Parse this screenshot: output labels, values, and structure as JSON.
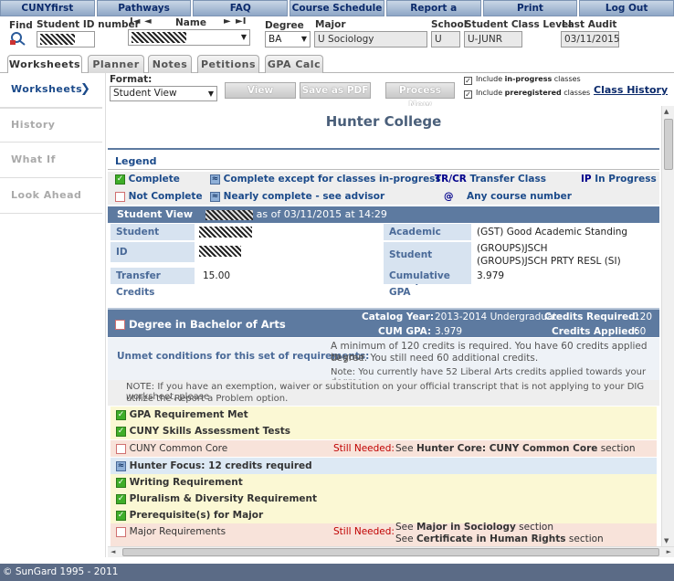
{
  "topnav": [
    "CUNYfirst",
    "Pathways",
    "FAQ",
    "Course Schedule",
    "Report a Problem",
    "Print",
    "Log Out"
  ],
  "header": {
    "find_label": "Find",
    "student_id_label": "Student ID number",
    "nav_first": "I◄",
    "nav_prev": "◄",
    "name_label": "Name",
    "nav_next": "►",
    "nav_last": "►I",
    "degree_label": "Degree",
    "degree_value": "BA",
    "major_label": "Major",
    "major_value": "U Sociology",
    "school_label": "School",
    "school_value": "U",
    "class_level_label": "Student Class Level",
    "class_level_value": "U-JUNR",
    "last_audit_label": "Last Audit",
    "last_audit_value": "03/11/2015"
  },
  "tabs": [
    "Worksheets",
    "Planner",
    "Notes",
    "Petitions",
    "GPA Calc"
  ],
  "sidebar": {
    "items": [
      "Worksheets",
      "History",
      "What If",
      "Look Ahead"
    ],
    "arrow": "❯"
  },
  "toolbar": {
    "format_label": "Format:",
    "format_value": "Student View",
    "view_button": "View",
    "save_pdf_button": "Save as PDF",
    "process_new_button": "Process New",
    "include_inprogress_pre": "Include ",
    "include_inprogress_bold": "in-progress",
    "include_inprogress_post": " classes",
    "include_prereg_pre": "Include ",
    "include_prereg_bold": "preregistered",
    "include_prereg_post": " classes",
    "class_history_link": "Class History"
  },
  "content": {
    "college_title": "Hunter College",
    "legend_title": "Legend",
    "legend": {
      "complete": "Complete",
      "complete_except": "Complete except for classes in-progress",
      "trcr_code": "TR/CR",
      "transfer_class": "Transfer Class",
      "ip_code": "IP",
      "in_progress": "In Progress",
      "not_complete": "Not Complete",
      "nearly_complete": "Nearly complete - see advisor",
      "any_course_code": "@",
      "any_course": "Any course number"
    },
    "student_view": {
      "title": "Student View",
      "as_of": "as of 03/11/2015 at 14:29",
      "student_label": "Student",
      "id_label": "ID",
      "transfer_credits_label": "Transfer Credits",
      "transfer_credits_value": "15.00",
      "academic_status_label": "Academic Status",
      "academic_status_value": "(GST) Good Academic Standing",
      "student_groups_label": "Student Groups",
      "student_groups_value_1": "(GROUPS)JSCH",
      "student_groups_value_2": "(GROUPS)JSCH PRTY RESL (SI)",
      "cumulative_gpa_label": "Cumulative GPA",
      "cumulative_gpa_value": "3.979"
    },
    "degree_block": {
      "title": "Degree in Bachelor of Arts",
      "catalog_year_label": "Catalog Year:",
      "catalog_year_value": "2013-2014 Undergraduate",
      "credits_required_label": "Credits Required:",
      "credits_required_value": "120",
      "cum_gpa_label": "CUM GPA:",
      "cum_gpa_value": "3.979",
      "credits_applied_label": "Credits Applied:",
      "credits_applied_value": "60",
      "unmet_label": "Unmet conditions for this set of requirements:",
      "unmet_text_1": "A minimum of 120 credits is required. You have 60 credits applied to your",
      "unmet_text_2": "degree. You still need 60 additional credits.",
      "unmet_note": "Note: You currently have 52 Liberal Arts credits applied towards your degree.",
      "note_1": "NOTE: If you have an exemption, waiver or substitution on your official transcript that is not applying to your DIG worksheet, please",
      "note_2": "utilize the Report a Problem option."
    },
    "requirements": [
      {
        "label": "GPA Requirement Met",
        "status": "complete"
      },
      {
        "label": "CUNY Skills Assessment Tests",
        "status": "complete"
      },
      {
        "label": "CUNY Common Core",
        "status": "not",
        "still": "Still Needed:",
        "see_pre": "See ",
        "see_bold": "Hunter Core: CUNY Common Core",
        "see_post": " section"
      },
      {
        "label": "Hunter Focus: 12 credits required",
        "status": "progress"
      },
      {
        "label": "Writing Requirement",
        "status": "complete"
      },
      {
        "label": "Pluralism & Diversity Requirement",
        "status": "complete"
      },
      {
        "label": "Prerequisite(s) for Major",
        "status": "complete"
      },
      {
        "label": "Major Requirements",
        "status": "not",
        "still": "Still Needed:",
        "see_pre": "See ",
        "see_bold": "Major in Sociology",
        "see_post": " section",
        "see2_pre": "See ",
        "see2_bold": "Certificate in Human Rights",
        "see2_post": " section"
      }
    ]
  },
  "footer": "© SunGard 1995 - 2011",
  "colors": {
    "nav_text": "#0b2a6b",
    "section_header": "#5d7aa0",
    "complete": "#3fae29",
    "not_complete": "#d07070",
    "still_needed": "#c00000"
  }
}
